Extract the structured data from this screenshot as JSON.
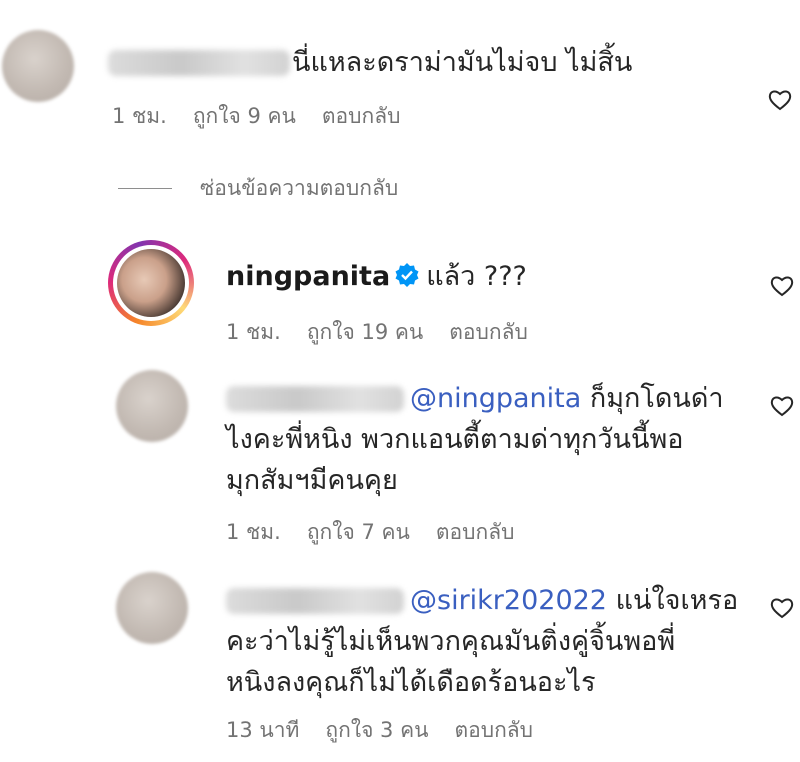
{
  "comments": [
    {
      "text": "นี่แหละดราม่ามันไม่จบ ไม่สิ้น",
      "time": "1 ชม.",
      "likes": "ถูกใจ 9 คน",
      "reply": "ตอบกลับ"
    }
  ],
  "hide_replies": "ซ่อนข้อความตอบกลับ",
  "replies": [
    {
      "username": "ningpanita",
      "text": "แล้ว ???",
      "time": "1 ชม.",
      "likes": "ถูกใจ 19 คน",
      "reply": "ตอบกลับ"
    },
    {
      "mention": "@ningpanita",
      "line1": "ก็มุกโดนด่า",
      "line2": "ไงคะพี่หนิง พวกแอนตี้ตามด่าทุกวันนี้พอ",
      "line3": "มุกสัมฯมีคนคุย",
      "time": "1 ชม.",
      "likes": "ถูกใจ 7 คน",
      "reply": "ตอบกลับ"
    },
    {
      "mention": "@sirikr202022",
      "line1": "แน่ใจเหรอ",
      "line2": "คะว่าไม่รู้ไม่เห็นพวกคุณมันติ่งคู่จิ้นพอพี่",
      "line3": "หนิงลงคุณก็ไม่ได้เดือดร้อนอะไร",
      "time": "13 นาที",
      "likes": "ถูกใจ 3 คน",
      "reply": "ตอบกลับ"
    }
  ],
  "colors": {
    "mention": "#3a5fc0",
    "meta": "#737373",
    "verified": "#0095f6"
  }
}
